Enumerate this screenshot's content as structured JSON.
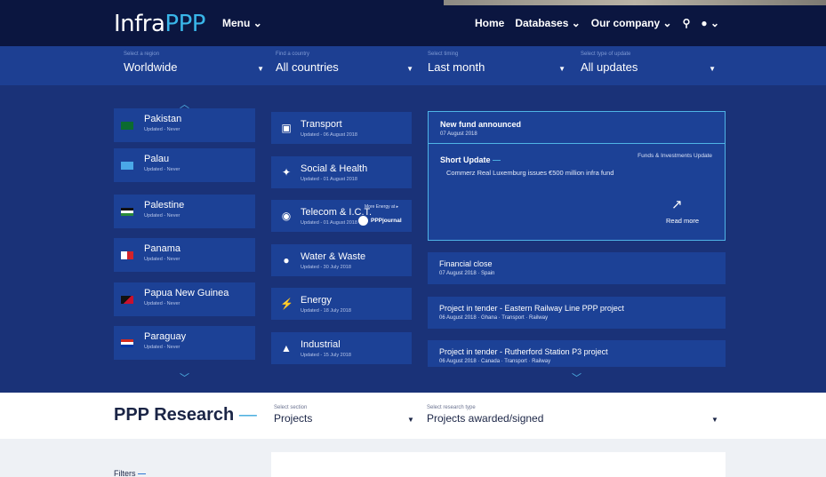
{
  "logo": {
    "infra": "Infra",
    "ppp": "PPP"
  },
  "menu_label": "Menu",
  "nav": {
    "home": "Home",
    "databases": "Databases",
    "company": "Our company"
  },
  "icons": {
    "caret": "chevron-down-icon",
    "search": "search-icon",
    "user": "user-icon",
    "up": "chevron-up-icon",
    "external": "external-link-icon"
  },
  "filters": [
    {
      "label": "Select a region",
      "value": "Worldwide"
    },
    {
      "label": "Find a country",
      "value": "All countries"
    },
    {
      "label": "Select timing",
      "value": "Last month"
    },
    {
      "label": "Select type of update",
      "value": "All updates"
    }
  ],
  "countries": [
    {
      "name": "Pakistan",
      "updated": "Updated - Never"
    },
    {
      "name": "Palau",
      "updated": "Updated - Never"
    },
    {
      "name": "Palestine",
      "updated": "Updated - Never"
    },
    {
      "name": "Panama",
      "updated": "Updated - Never"
    },
    {
      "name": "Papua New Guinea",
      "updated": "Updated - Never"
    },
    {
      "name": "Paraguay",
      "updated": "Updated - Never"
    }
  ],
  "sectors": [
    {
      "name": "Transport",
      "updated": "Updated - 06 August 2018"
    },
    {
      "name": "Social & Health",
      "updated": "Updated - 01 August 2018"
    },
    {
      "name": "Telecom & I.C.T.",
      "updated": "Updated - 01 August 2018"
    },
    {
      "name": "Water & Waste",
      "updated": "Updated - 30 July 2018"
    },
    {
      "name": "Energy",
      "updated": "Updated - 18 July 2018"
    },
    {
      "name": "Industrial",
      "updated": "Updated - 15 July 2018"
    }
  ],
  "energy_more": "More Energy at",
  "pppjournal": "PPPjournal",
  "featured": {
    "title": "New fund announced",
    "date": "07 August 2018",
    "category": "Funds & Investments Update",
    "heading": "Short Update",
    "text": "Commerz Real Luxemburg issues €500 million infra fund",
    "read_more": "Read more"
  },
  "news": [
    {
      "title": "Financial close",
      "meta": "07 August 2018 · Spain"
    },
    {
      "title": "Project in tender - Eastern Railway Line PPP project",
      "meta": "06 August 2018 · Ghana · Transport · Railway"
    },
    {
      "title": "Project in tender - Rutherford Station P3 project",
      "meta": "06 August 2018 · Canada · Transport · Railway"
    }
  ],
  "research": {
    "title": "PPP Research",
    "section_label": "Select section",
    "section_value": "Projects",
    "type_label": "Select research type",
    "type_value": "Projects awarded/signed"
  },
  "filters_label": "Filters",
  "colors": {
    "navy": "#0b1640",
    "blue": "#1d3f92",
    "panel": "#1a3278",
    "accent": "#39b6e9"
  }
}
